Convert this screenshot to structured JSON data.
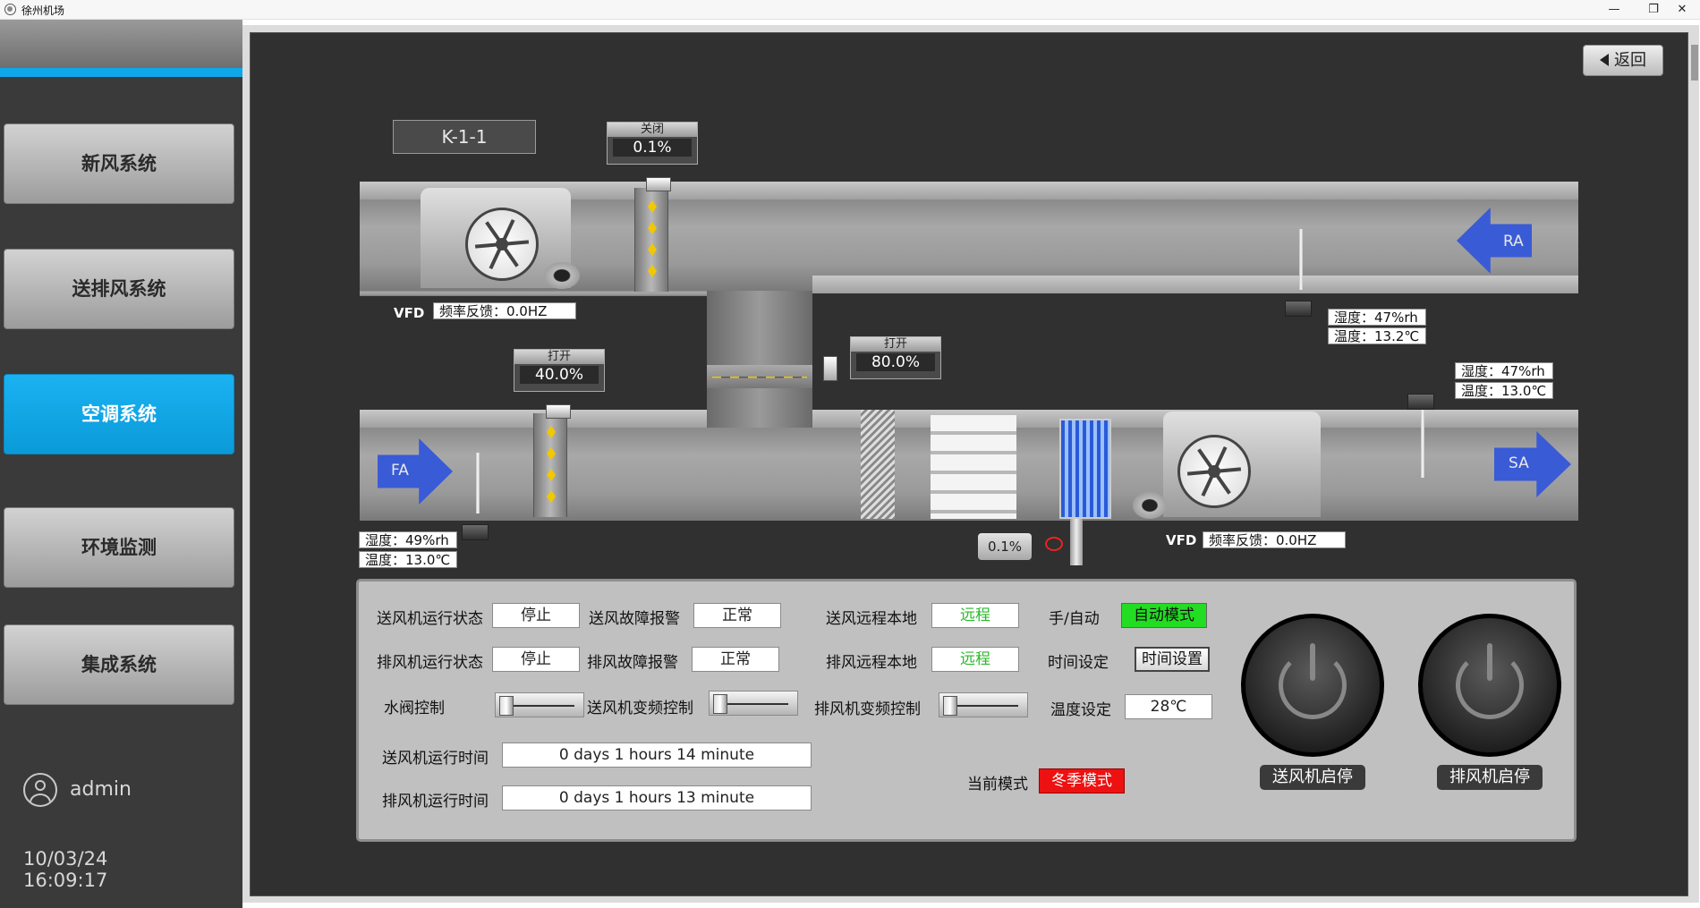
{
  "window": {
    "title": "徐州机场",
    "icon": "app-icon",
    "minimize": "—",
    "restore": "❐",
    "close": "✕"
  },
  "sidebar": {
    "items": [
      {
        "label": "新风系统",
        "active": false
      },
      {
        "label": "送排风系统",
        "active": false
      },
      {
        "label": "空调系统",
        "active": true
      },
      {
        "label": "环境监测",
        "active": false
      },
      {
        "label": "集成系统",
        "active": false
      }
    ],
    "user": {
      "name": "admin",
      "icon": "user-icon"
    },
    "date": "10/03/24",
    "time": "16:09:17"
  },
  "header": {
    "back_label": "返回",
    "unit_name": "K-1-1"
  },
  "diagram": {
    "top_damper": {
      "caption": "关闭",
      "value": "0.1%"
    },
    "bottom_damper": {
      "caption": "打开",
      "value": "40.0%"
    },
    "mix_damper": {
      "caption": "打开",
      "value": "80.0%"
    },
    "return_fan": {
      "vfd": "VFD",
      "feedback": "频率反馈：0.0HZ"
    },
    "supply_fan": {
      "vfd": "VFD",
      "feedback": "频率反馈：0.0HZ"
    },
    "ra_sensor": {
      "humidity": "湿度：47%rh",
      "temperature": "温度：13.2℃"
    },
    "sa_sensor": {
      "humidity": "湿度：47%rh",
      "temperature": "温度：13.0℃"
    },
    "fa_sensor": {
      "humidity": "湿度：49%rh",
      "temperature": "温度：13.0℃"
    },
    "water_valve": "0.1%",
    "arrows": {
      "ra": "RA",
      "fa": "FA",
      "sa": "SA"
    }
  },
  "controls": {
    "supply_fan_status": {
      "label": "送风机运行状态",
      "value": "停止"
    },
    "exhaust_fan_status": {
      "label": "排风机运行状态",
      "value": "停止"
    },
    "supply_fault": {
      "label": "送风故障报警",
      "value": "正常"
    },
    "exhaust_fault": {
      "label": "排风故障报警",
      "value": "正常"
    },
    "supply_remote": {
      "label": "送风远程本地",
      "value": "远程"
    },
    "exhaust_remote": {
      "label": "排风远程本地",
      "value": "远程"
    },
    "manual_auto": {
      "label": "手/自动",
      "value": "自动模式"
    },
    "time_setting": {
      "label": "时间设定",
      "button": "时间设置"
    },
    "temp_setting": {
      "label": "温度设定",
      "value": "28℃"
    },
    "water_valve_ctrl": {
      "label": "水阀控制"
    },
    "supply_vfd_ctrl": {
      "label": "送风机变频控制"
    },
    "exhaust_vfd_ctrl": {
      "label": "排风机变频控制"
    },
    "supply_runtime": {
      "label": "送风机运行时间",
      "value": "0 days 1 hours 14 minute"
    },
    "exhaust_runtime": {
      "label": "排风机运行时间",
      "value": "0 days 1 hours 13 minute"
    },
    "current_mode": {
      "label": "当前模式",
      "value": "冬季模式"
    },
    "supply_power": {
      "label": "送风机启停",
      "icon": "power-icon"
    },
    "exhaust_power": {
      "label": "排风机启停",
      "icon": "power-icon"
    }
  }
}
